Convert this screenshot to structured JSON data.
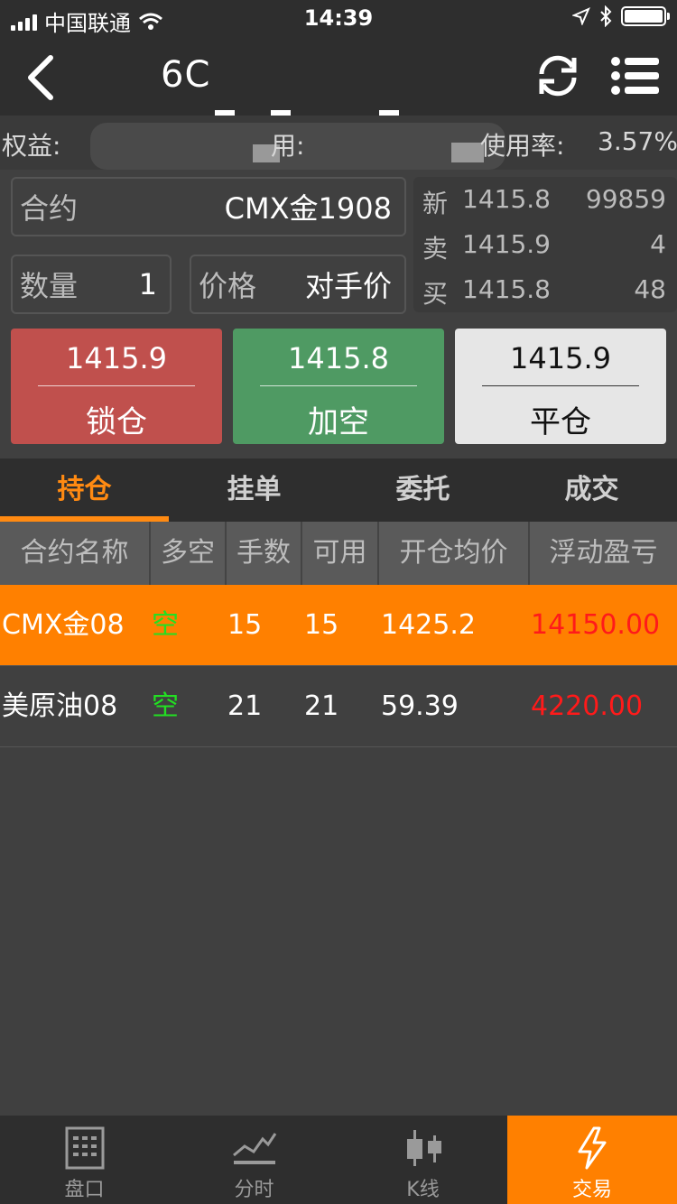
{
  "status_bar": {
    "carrier": "中国联通",
    "time": "14:39"
  },
  "header": {
    "title": "6C"
  },
  "account": {
    "equity_label": "权益:",
    "used_label": "用:",
    "usage_label": "使用率:",
    "usage_value": "3.57%"
  },
  "order": {
    "contract_label": "合约",
    "contract_value": "CMX金1908",
    "qty_label": "数量",
    "qty_value": "1",
    "price_label": "价格",
    "price_value": "对手价"
  },
  "quotes": [
    {
      "label": "新",
      "price": "1415.8",
      "volume": "99859"
    },
    {
      "label": "卖",
      "price": "1415.9",
      "volume": "4"
    },
    {
      "label": "买",
      "price": "1415.8",
      "volume": "48"
    }
  ],
  "actions": {
    "lock": {
      "price": "1415.9",
      "label": "锁仓",
      "color": "#c0504d"
    },
    "short": {
      "price": "1415.8",
      "label": "加空",
      "color": "#4f9a63"
    },
    "close": {
      "price": "1415.9",
      "label": "平仓",
      "color": "#e6e6e6"
    }
  },
  "tabs": [
    "持仓",
    "挂单",
    "委托",
    "成交"
  ],
  "active_tab": "持仓",
  "table": {
    "headers": [
      "合约名称",
      "多空",
      "手数",
      "可用",
      "开仓均价",
      "浮动盈亏"
    ],
    "rows": [
      {
        "name": "CMX金08",
        "direction": "空",
        "lots": "15",
        "available": "15",
        "avg_price": "1425.2",
        "pnl": "14150.00",
        "selected": true
      },
      {
        "name": "美原油08",
        "direction": "空",
        "lots": "21",
        "available": "21",
        "avg_price": "59.39",
        "pnl": "4220.00",
        "selected": false
      }
    ]
  },
  "bottom_nav": [
    {
      "label": "盘口",
      "icon": "order-book-icon"
    },
    {
      "label": "分时",
      "icon": "timeshare-chart-icon"
    },
    {
      "label": "K线",
      "icon": "candlestick-icon"
    },
    {
      "label": "交易",
      "icon": "lightning-icon",
      "active": true
    }
  ],
  "colors": {
    "accent": "#ff8000",
    "buy_red": "#ff1a1a",
    "short_green": "#22e022",
    "background": "#404040"
  }
}
